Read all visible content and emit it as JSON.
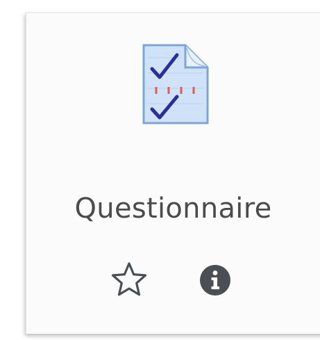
{
  "activity": {
    "title": "Questionnaire",
    "icon": "questionnaire-document-icon",
    "favorite_icon": "star-outline-icon",
    "info_icon": "info-circle-icon"
  },
  "colors": {
    "title_text": "#4b4b4b",
    "doc_fill": "#cfe2f7",
    "doc_border": "#7ea4d8",
    "check": "#2a2f96",
    "dash": "#e15a5a",
    "action_icon": "#4a4f55"
  }
}
